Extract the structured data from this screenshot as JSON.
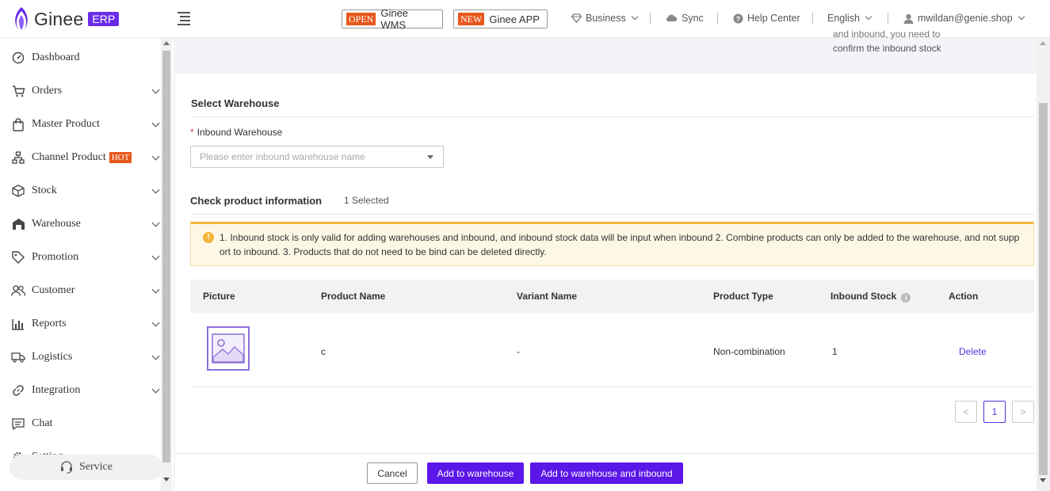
{
  "header": {
    "logo_text": "Ginee",
    "logo_badge": "ERP",
    "wms": {
      "tag": "OPEN",
      "label": "Ginee WMS"
    },
    "app": {
      "tag": "NEW",
      "label": "Ginee APP"
    },
    "business": "Business",
    "sync": "Sync",
    "help": "Help Center",
    "language": "English",
    "user": "mwildan@genie.shop"
  },
  "sidebar": {
    "items": [
      {
        "label": "Dashboard",
        "icon": "dashboard-icon"
      },
      {
        "label": "Orders",
        "icon": "cart-icon"
      },
      {
        "label": "Master Product",
        "icon": "bag-icon"
      },
      {
        "label": "Channel Product",
        "icon": "sitemap-icon",
        "badge": "HOT"
      },
      {
        "label": "Stock",
        "icon": "box-icon"
      },
      {
        "label": "Warehouse",
        "icon": "warehouse-icon"
      },
      {
        "label": "Promotion",
        "icon": "tag-icon"
      },
      {
        "label": "Customer",
        "icon": "users-icon"
      },
      {
        "label": "Reports",
        "icon": "bar-chart-icon"
      },
      {
        "label": "Logistics",
        "icon": "truck-icon"
      },
      {
        "label": "Integration",
        "icon": "link-icon"
      },
      {
        "label": "Chat",
        "icon": "chat-icon"
      },
      {
        "label": "Setting",
        "icon": "settings-icon"
      }
    ],
    "service": "Service"
  },
  "top_note": {
    "line1": "and inbound, you need to",
    "line2": "confirm the inbound stock"
  },
  "warehouse_section": {
    "title": "Select Warehouse",
    "field_label": "Inbound Warehouse",
    "placeholder": "Please enter inbound warehouse name"
  },
  "product_section": {
    "title": "Check product information",
    "selected": "1 Selected",
    "alert_line1": "1. Inbound stock is only valid for adding warehouses and inbound, and inbound stock data will be input when inbound 2. Combine products can only be added to the warehouse, and not supp",
    "alert_line2": "ort to inbound. 3. Products that do not need to be bind can be deleted directly."
  },
  "table": {
    "columns": [
      "Picture",
      "Product Name",
      "Variant Name",
      "Product Type",
      "Inbound Stock",
      "Action"
    ],
    "rows": [
      {
        "product_name": "c",
        "variant_name": "-",
        "product_type": "Non-combination",
        "inbound_stock": "1",
        "action": "Delete"
      }
    ]
  },
  "pagination": {
    "prev": "<",
    "current": "1",
    "next": ">"
  },
  "footer": {
    "cancel": "Cancel",
    "add": "Add to warehouse",
    "add_inbound": "Add to warehouse and inbound"
  },
  "colors": {
    "brand": "#5b16e8",
    "hot": "#e8581c",
    "warning": "#f5b53a"
  }
}
